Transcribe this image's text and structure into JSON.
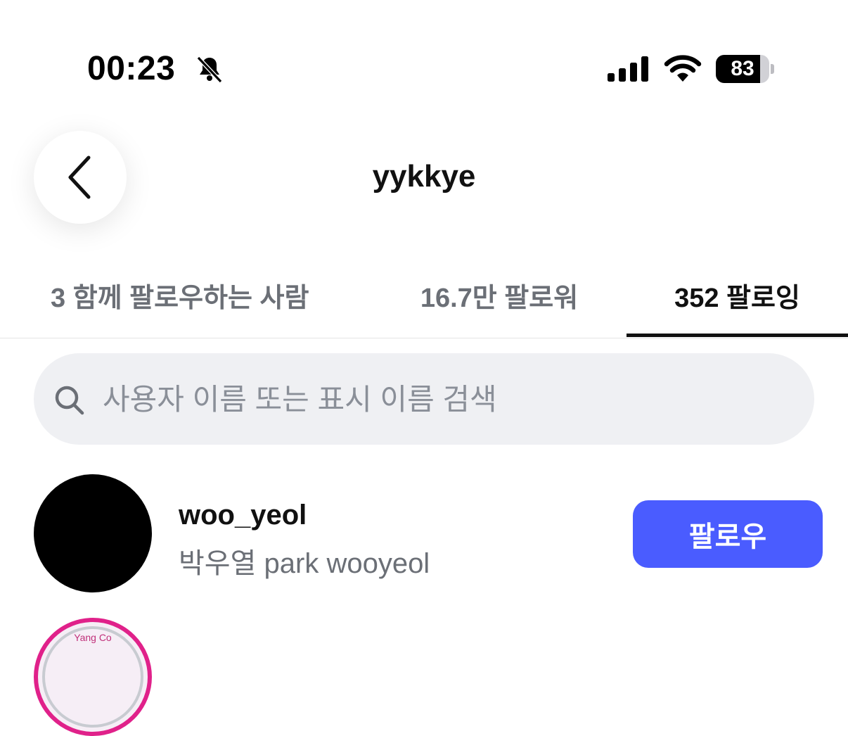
{
  "status_bar": {
    "time": "00:23",
    "battery_percent": "83",
    "battery_level": 0.83,
    "icons": [
      "bell-slash-icon",
      "cellular-signal-icon",
      "wifi-icon",
      "battery-icon"
    ]
  },
  "header": {
    "title": "yykkye",
    "back_icon": "chevron-left-icon"
  },
  "tabs": [
    {
      "label": "3 함께 팔로우하는 사람",
      "active": false
    },
    {
      "label": "16.7만 팔로워",
      "active": false
    },
    {
      "label": "352 팔로잉",
      "active": true
    }
  ],
  "search": {
    "placeholder": "사용자 이름 또는 표시 이름 검색",
    "value": "",
    "icon": "search-icon"
  },
  "list": [
    {
      "username": "woo_yeol",
      "display_name": "박우열 park wooyeol",
      "button_label": "팔로우"
    },
    {
      "logo_text": "Yang Co"
    }
  ],
  "colors": {
    "accent": "#4a5cff",
    "search_bg": "#eff0f3",
    "muted_text": "#6b6f76",
    "story_ring": "#e0218a"
  }
}
